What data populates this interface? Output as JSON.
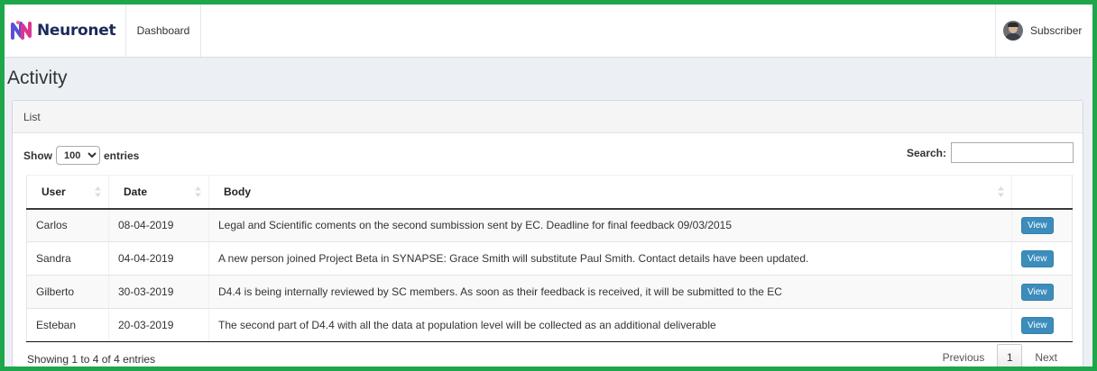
{
  "brand": {
    "name": "Neuronet"
  },
  "nav": {
    "dashboard": "Dashboard"
  },
  "user": {
    "name": "Subscriber"
  },
  "page": {
    "title": "Activity"
  },
  "box": {
    "title": "List"
  },
  "length": {
    "prefix": "Show",
    "suffix": "entries",
    "selected": "100"
  },
  "search": {
    "label": "Search:",
    "value": ""
  },
  "table": {
    "headers": {
      "user": "User",
      "date": "Date",
      "body": "Body"
    },
    "rows": [
      {
        "user": "Carlos",
        "date": "08-04-2019",
        "body": "Legal and Scientific coments on the second sumbission sent by EC. Deadline for final feedback 09/03/2015",
        "action": "View"
      },
      {
        "user": "Sandra",
        "date": "04-04-2019",
        "body": "A new person joined Project Beta in SYNAPSE: Grace Smith will substitute Paul Smith. Contact details have been updated.",
        "action": "View"
      },
      {
        "user": "Gilberto",
        "date": "30-03-2019",
        "body": "D4.4 is being internally reviewed by SC members. As soon as their feedback is received, it will be submitted to the EC",
        "action": "View"
      },
      {
        "user": "Esteban",
        "date": "20-03-2019",
        "body": "The second part of D4.4 with all the data at population level will be collected as an additional deliverable",
        "action": "View"
      }
    ]
  },
  "footer": {
    "info": "Showing 1 to 4 of 4 entries",
    "previous": "Previous",
    "page": "1",
    "next": "Next"
  },
  "colors": {
    "frame": "#1ea64a",
    "primary": "#3c8dbc",
    "background": "#ecf0f5"
  }
}
